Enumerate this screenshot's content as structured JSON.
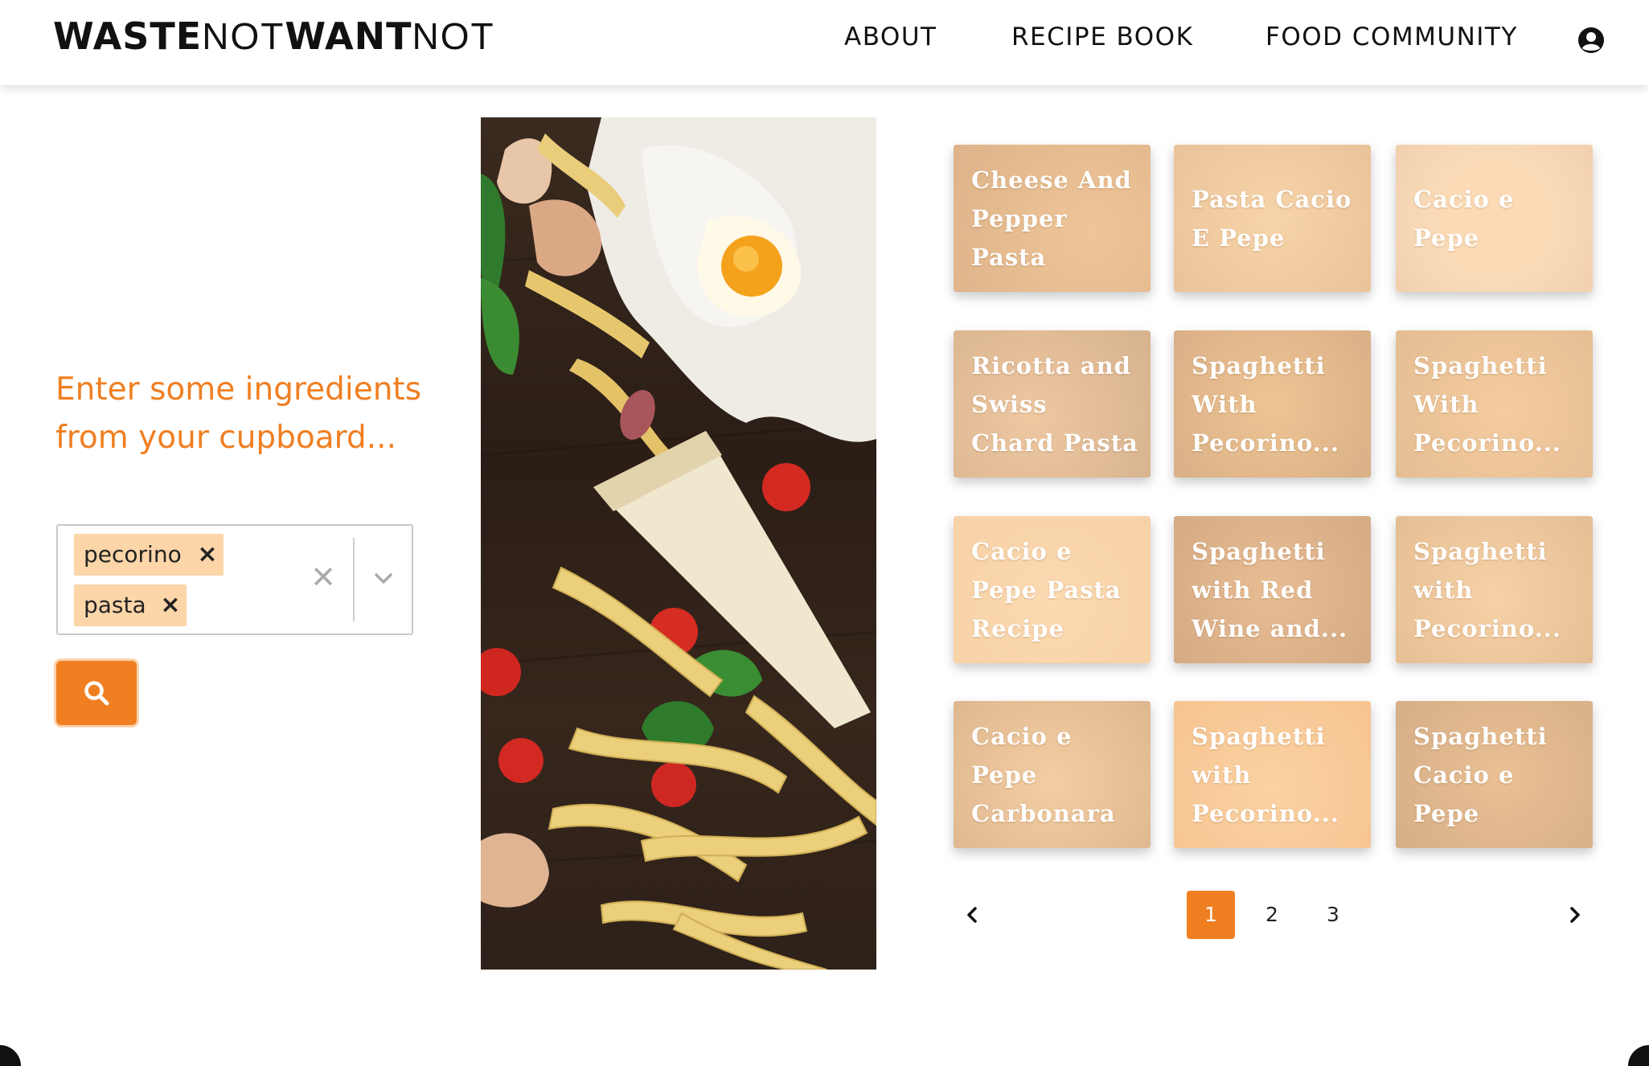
{
  "brand": {
    "part1": "WASTE",
    "part2": "NOT",
    "part3": "WANT",
    "part4": "NOT"
  },
  "nav": {
    "about": "ABOUT",
    "recipe_book": "RECIPE BOOK",
    "food_community": "FOOD COMMUNITY",
    "user_icon": "user-circle-icon"
  },
  "search_panel": {
    "prompt": "Enter some ingredients from your cupboard...",
    "tags": [
      "pecorino",
      "pasta"
    ],
    "tag_remove_glyph": "×",
    "clear_glyph": "✕",
    "accent_color": "#f07f22",
    "tag_color": "#fcd5a8"
  },
  "recipes": [
    {
      "title": "Cheese And Pepper Pasta (caci..."
    },
    {
      "title": "Pasta Cacio E Pepe"
    },
    {
      "title": "Cacio e Pepe"
    },
    {
      "title": "Ricotta and Swiss Chard Pasta"
    },
    {
      "title": "Spaghetti With Pecorino..."
    },
    {
      "title": "Spaghetti With Pecorino..."
    },
    {
      "title": "Cacio e Pepe Pasta Recipe"
    },
    {
      "title": "Spaghetti with Red Wine and..."
    },
    {
      "title": "Spaghetti with Pecorino..."
    },
    {
      "title": "Cacio e Pepe Carbonara"
    },
    {
      "title": "Spaghetti with Pecorino..."
    },
    {
      "title": "Spaghetti Cacio e Pepe"
    }
  ],
  "pagination": {
    "pages": [
      "1",
      "2",
      "3"
    ],
    "current": "1"
  }
}
